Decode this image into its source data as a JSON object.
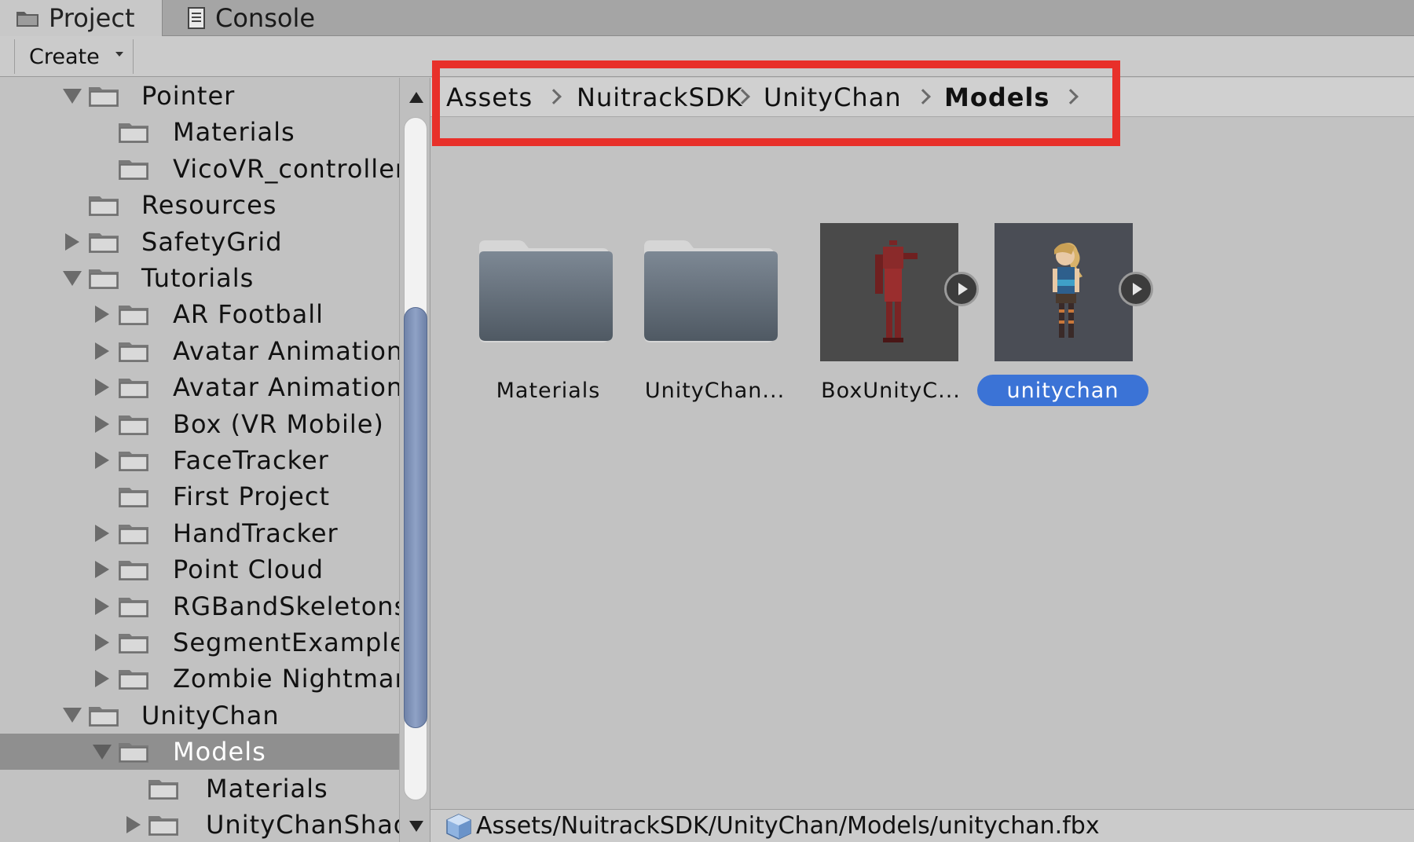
{
  "tabs": [
    {
      "label": "Project",
      "icon": "folder-icon",
      "active": true
    },
    {
      "label": "Console",
      "icon": "console-icon",
      "active": false
    }
  ],
  "toolbar": {
    "create_label": "Create"
  },
  "tree": {
    "items": [
      {
        "label": "Pointer",
        "depth": 1,
        "expand": "down"
      },
      {
        "label": "Materials",
        "depth": 2,
        "expand": "none"
      },
      {
        "label": "VicoVR_controller",
        "depth": 2,
        "expand": "none"
      },
      {
        "label": "Resources",
        "depth": 1,
        "expand": "none"
      },
      {
        "label": "SafetyGrid",
        "depth": 1,
        "expand": "right"
      },
      {
        "label": "Tutorials",
        "depth": 1,
        "expand": "down"
      },
      {
        "label": "AR Football",
        "depth": 2,
        "expand": "right"
      },
      {
        "label": "Avatar Animation",
        "depth": 2,
        "expand": "right"
      },
      {
        "label": "Avatar Animation",
        "depth": 2,
        "expand": "right"
      },
      {
        "label": "Box (VR Mobile)",
        "depth": 2,
        "expand": "right"
      },
      {
        "label": "FaceTracker",
        "depth": 2,
        "expand": "right"
      },
      {
        "label": "First Project",
        "depth": 2,
        "expand": "none"
      },
      {
        "label": "HandTracker",
        "depth": 2,
        "expand": "right"
      },
      {
        "label": "Point Cloud",
        "depth": 2,
        "expand": "right"
      },
      {
        "label": "RGBandSkeletons",
        "depth": 2,
        "expand": "right"
      },
      {
        "label": "SegmentExample",
        "depth": 2,
        "expand": "right"
      },
      {
        "label": "Zombie Nightmare",
        "depth": 2,
        "expand": "right"
      },
      {
        "label": "UnityChan",
        "depth": 1,
        "expand": "down"
      },
      {
        "label": "Models",
        "depth": 2,
        "expand": "down",
        "selected": true
      },
      {
        "label": "Materials",
        "depth": 3,
        "expand": "none"
      },
      {
        "label": "UnityChanShader",
        "depth": 3,
        "expand": "right"
      }
    ]
  },
  "breadcrumb": [
    {
      "label": "Assets"
    },
    {
      "label": "NuitrackSDK"
    },
    {
      "label": "UnityChan"
    },
    {
      "label": "Models",
      "current": true
    }
  ],
  "assets": [
    {
      "label": "Materials",
      "kind": "folder",
      "icon": "folder-icon"
    },
    {
      "label": "UnityChan...",
      "kind": "folder",
      "icon": "folder-icon"
    },
    {
      "label": "BoxUnityC...",
      "kind": "model",
      "icon": "box-model-thumbnail"
    },
    {
      "label": "unitychan",
      "kind": "model",
      "icon": "unitychan-model-thumbnail",
      "selected": true
    }
  ],
  "status": {
    "path": "Assets/NuitrackSDK/UnityChan/Models/unitychan.fbx",
    "icon": "prefab-cube-icon"
  },
  "colors": {
    "highlight": "#e8302a",
    "selection": "#3b73d6",
    "tree_selection": "#8f8f8f"
  }
}
